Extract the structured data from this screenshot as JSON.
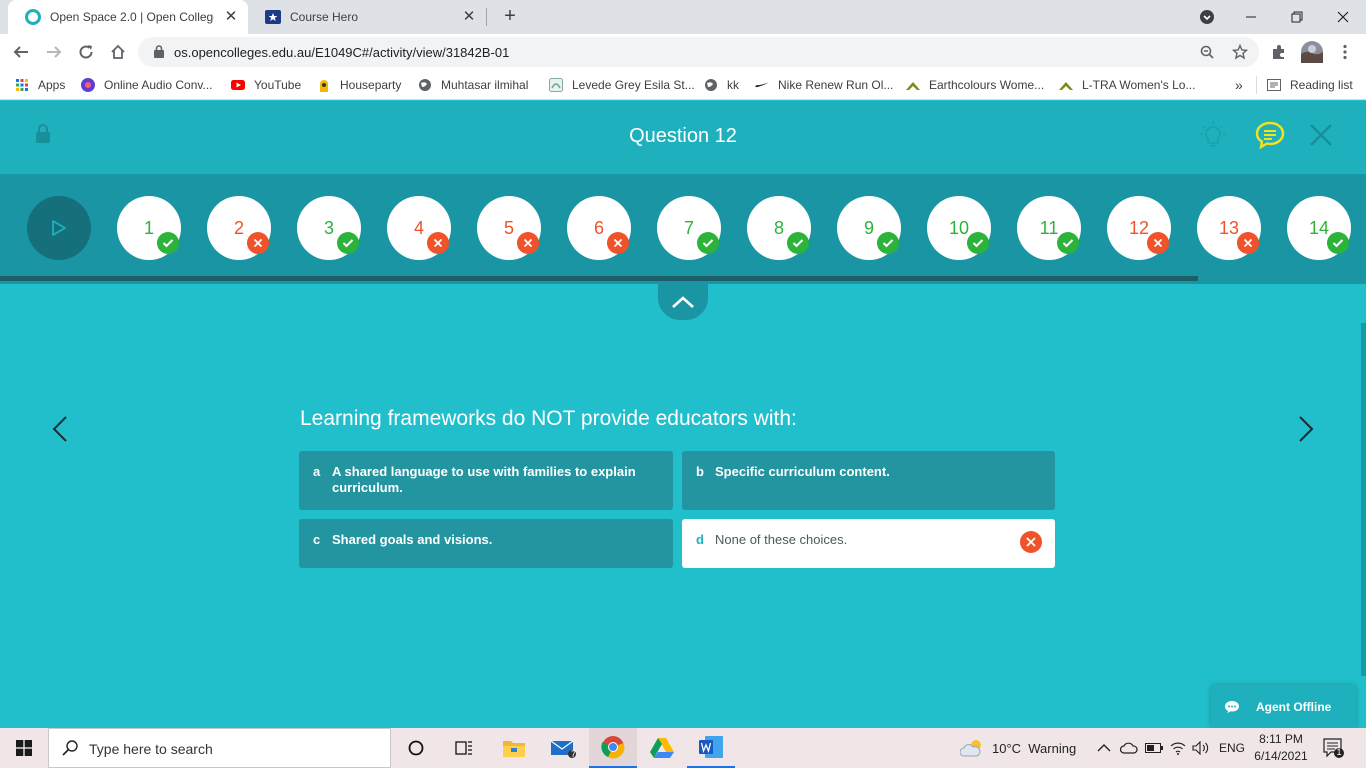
{
  "browser": {
    "tabs": [
      {
        "title": "Open Space 2.0 | Open Colleges",
        "active": true
      },
      {
        "title": "Course Hero",
        "active": false
      }
    ],
    "url": "os.opencolleges.edu.au/E1049C#/activity/view/31842B-01",
    "bookmarks": [
      {
        "label": "Apps",
        "icon": "apps-grid-icon"
      },
      {
        "label": "Online Audio Conv...",
        "icon": "audio-converter-icon"
      },
      {
        "label": "YouTube",
        "icon": "youtube-icon"
      },
      {
        "label": "Houseparty",
        "icon": "houseparty-icon"
      },
      {
        "label": "Muhtasar ilmihal",
        "icon": "globe-icon"
      },
      {
        "label": "Levede Grey Esila St...",
        "icon": "levede-icon"
      },
      {
        "label": "kk",
        "icon": "globe-icon"
      },
      {
        "label": "Nike Renew Run Ol...",
        "icon": "nike-icon"
      },
      {
        "label": "Earthcolours Wome...",
        "icon": "mountain-icon"
      },
      {
        "label": "L-TRA Women's Lo...",
        "icon": "mountain-icon"
      }
    ],
    "overflow_label": "»",
    "reading_list_label": "Reading list"
  },
  "app": {
    "question_title": "Question 12",
    "questions": [
      {
        "num": "1",
        "status": "correct"
      },
      {
        "num": "2",
        "status": "incorrect"
      },
      {
        "num": "3",
        "status": "correct"
      },
      {
        "num": "4",
        "status": "incorrect"
      },
      {
        "num": "5",
        "status": "incorrect"
      },
      {
        "num": "6",
        "status": "incorrect"
      },
      {
        "num": "7",
        "status": "correct"
      },
      {
        "num": "8",
        "status": "correct"
      },
      {
        "num": "9",
        "status": "correct"
      },
      {
        "num": "10",
        "status": "correct"
      },
      {
        "num": "11",
        "status": "correct"
      },
      {
        "num": "12",
        "status": "incorrect"
      },
      {
        "num": "13",
        "status": "incorrect"
      },
      {
        "num": "14",
        "status": "correct"
      }
    ],
    "question_text": "Learning frameworks do NOT provide educators with:",
    "answers": [
      {
        "letter": "a",
        "line1": "A shared language to use with families to explain",
        "line2": "curriculum.",
        "selected": false
      },
      {
        "letter": "b",
        "line1": "Specific curriculum content.",
        "line2": "",
        "selected": false
      },
      {
        "letter": "c",
        "line1": "Shared goals and visions.",
        "line2": "",
        "selected": false
      },
      {
        "letter": "d",
        "line1": "None of these choices.",
        "line2": "",
        "selected": true,
        "result": "incorrect"
      }
    ],
    "agent_label": "Agent Offline",
    "colors": {
      "header": "#1fb0be",
      "background": "#21bfcc",
      "correct": "#2bb33a",
      "incorrect": "#f0522a",
      "hint_icon": "#f4e21c"
    }
  },
  "taskbar": {
    "search_placeholder": "Type here to search",
    "mail_badge": "7",
    "weather": "10°C  Warning",
    "language": "ENG",
    "time": "8:11 PM",
    "date": "6/14/2021",
    "notification_count": "1"
  }
}
